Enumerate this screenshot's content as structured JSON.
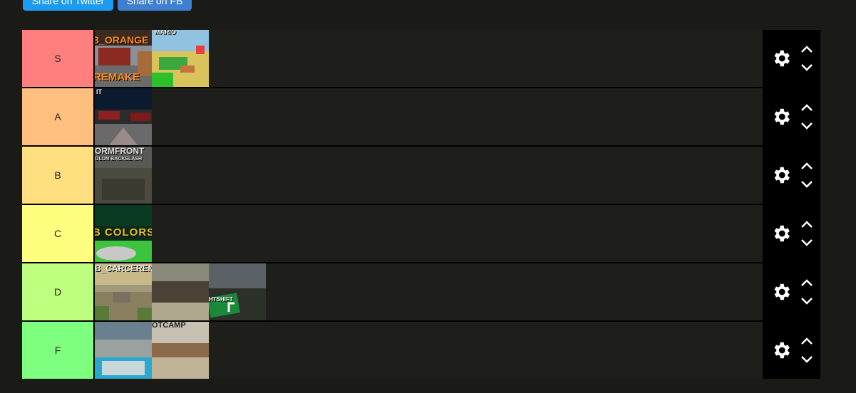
{
  "share": {
    "twitter_label": "Share on Twitter",
    "other_label": "Share on FB"
  },
  "tiers": [
    {
      "label": "S",
      "color": "#ff7f7f",
      "items": [
        {
          "caption": "B_ORANGE",
          "caption2": "REMAKE"
        },
        {
          "caption": "MARIO",
          "caption2": ""
        }
      ]
    },
    {
      "label": "A",
      "color": "#ffbf7f",
      "items": [
        {
          "caption": "IT",
          "caption2": ""
        }
      ]
    },
    {
      "label": "B",
      "color": "#ffdf7f",
      "items": [
        {
          "caption": "ORMFRONT",
          "caption2": "OLON BACKSLASH"
        }
      ]
    },
    {
      "label": "C",
      "color": "#ffff7f",
      "items": [
        {
          "caption": "B COLORS",
          "caption2": ""
        }
      ]
    },
    {
      "label": "D",
      "color": "#bfff7f",
      "items": [
        {
          "caption": "B_CARCEREM",
          "caption2": ""
        },
        {
          "caption": "",
          "caption2": ""
        },
        {
          "caption": "HTSHIFT",
          "caption2": ""
        }
      ]
    },
    {
      "label": "F",
      "color": "#7fff7f",
      "items": [
        {
          "caption": "",
          "caption2": ""
        },
        {
          "caption": "OTCAMP",
          "caption2": ""
        }
      ]
    }
  ],
  "icons": {
    "settings": "gear-icon",
    "move_up": "chevron-up-icon",
    "move_down": "chevron-down-icon"
  }
}
